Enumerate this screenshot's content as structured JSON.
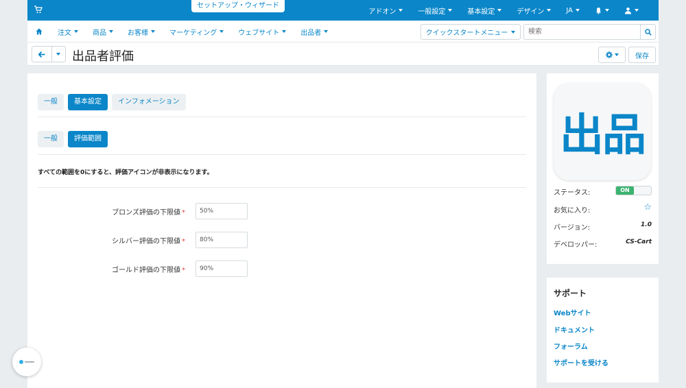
{
  "topbar": {
    "wizard_label": "セットアップ・ウィザード",
    "menu": [
      {
        "label": "アドオン"
      },
      {
        "label": "一般設定"
      },
      {
        "label": "基本設定"
      },
      {
        "label": "デザイン"
      },
      {
        "label": "JA"
      }
    ]
  },
  "nav": {
    "items": [
      {
        "label": "注文"
      },
      {
        "label": "商品"
      },
      {
        "label": "お客様"
      },
      {
        "label": "マーケティング"
      },
      {
        "label": "ウェブサイト"
      },
      {
        "label": "出品者"
      }
    ],
    "quickstart_label": "クイックスタートメニュー",
    "search_placeholder": "検索"
  },
  "titlebar": {
    "title": "出品者評価",
    "save_label": "保存"
  },
  "main": {
    "tabs": [
      {
        "label": "一般",
        "active": false
      },
      {
        "label": "基本設定",
        "active": true
      },
      {
        "label": "インフォメーション",
        "active": false
      }
    ],
    "subtabs": [
      {
        "label": "一般",
        "active": false
      },
      {
        "label": "評価範囲",
        "active": true
      }
    ],
    "note": "すべての範囲を0にすると、評価アイコンが非表示になります。",
    "fields": [
      {
        "label": "ブロンズ評価の下限値",
        "value": "50%"
      },
      {
        "label": "シルバー評価の下限値",
        "value": "80%"
      },
      {
        "label": "ゴールド評価の下限値",
        "value": "90%"
      }
    ],
    "required_mark": "*"
  },
  "addon": {
    "logo_text": "出品",
    "status_label": "ステータス:",
    "status_value": "ON",
    "favorite_label": "お気に入り:",
    "version_label": "バージョン:",
    "version_value": "1.0",
    "developer_label": "デベロッパー:",
    "developer_value": "CS-Cart"
  },
  "support": {
    "heading": "サポート",
    "links": [
      {
        "label": "Webサイト"
      },
      {
        "label": "ドキュメント"
      },
      {
        "label": "フォーラム"
      },
      {
        "label": "サポートを受ける"
      }
    ]
  },
  "colors": {
    "accent": "#0a86c9",
    "status_on": "#3cb371",
    "required": "#e0453a"
  }
}
